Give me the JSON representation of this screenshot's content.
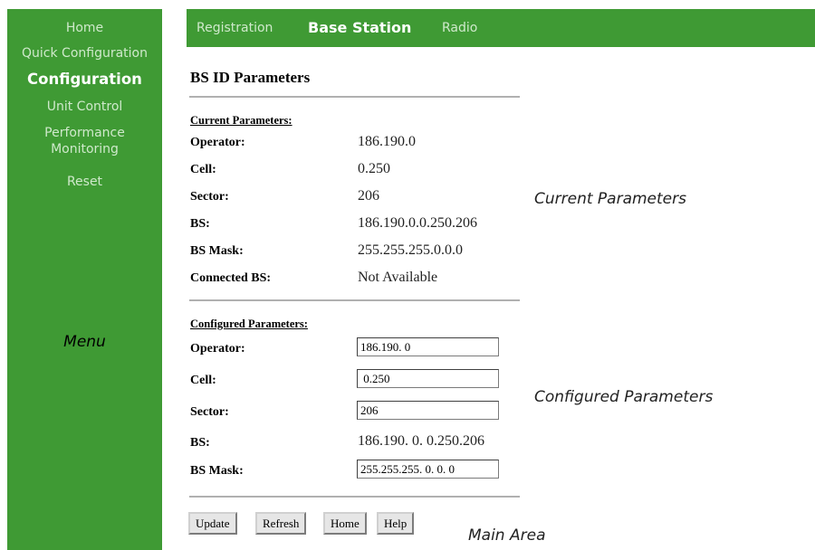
{
  "sidebar": {
    "items": [
      {
        "label": "Home"
      },
      {
        "label": "Quick Configuration"
      },
      {
        "label": "Configuration"
      },
      {
        "label": "Unit Control"
      },
      {
        "label": "Performance"
      },
      {
        "label": "Monitoring"
      },
      {
        "label": "Reset"
      }
    ],
    "caption": "Menu"
  },
  "tabs": [
    {
      "label": "Registration"
    },
    {
      "label": "Base Station"
    },
    {
      "label": "Radio"
    }
  ],
  "page_title": "BS ID Parameters",
  "current": {
    "heading": "Current Parameters:",
    "rows": [
      {
        "label": "Operator:",
        "value": "186.190.0"
      },
      {
        "label": "Cell:",
        "value": "0.250"
      },
      {
        "label": "Sector:",
        "value": "206"
      },
      {
        "label": "BS:",
        "value": "186.190.0.0.250.206"
      },
      {
        "label": "BS Mask:",
        "value": "255.255.255.0.0.0"
      },
      {
        "label": "Connected BS:",
        "value": "Not Available"
      }
    ],
    "annotation": "Current Parameters"
  },
  "configured": {
    "heading": "Configured Parameters:",
    "operator_label": "Operator:",
    "operator_value": "186.190. 0",
    "cell_label": "Cell:",
    "cell_value": " 0.250",
    "sector_label": "Sector:",
    "sector_value": "206",
    "bs_label": "BS:",
    "bs_value": "186.190. 0. 0.250.206",
    "mask_label": "BS Mask:",
    "mask_value": "255.255.255. 0. 0. 0",
    "annotation": "Configured Parameters"
  },
  "buttons": {
    "update": "Update",
    "refresh": "Refresh",
    "home": "Home",
    "help": "Help"
  },
  "main_caption": "Main Area",
  "colors": {
    "nav_green": "#3f9a34"
  }
}
